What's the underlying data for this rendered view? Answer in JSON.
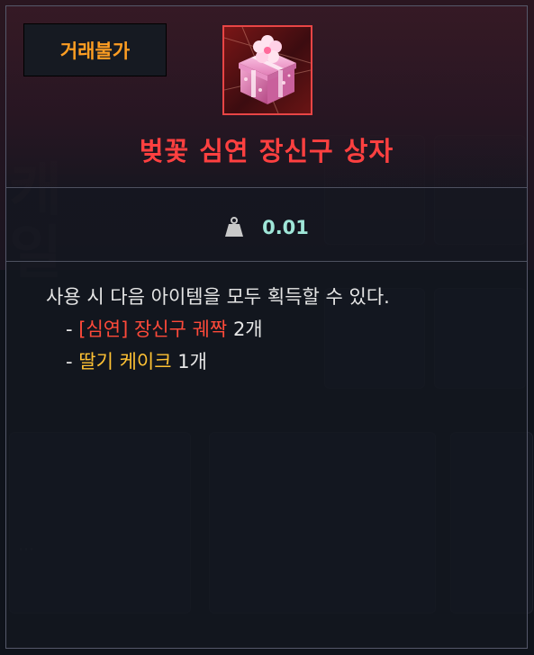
{
  "badge": {
    "label": "거래불가"
  },
  "item": {
    "name": "벚꽃 심연 장신구 상자",
    "weight": "0.01",
    "icon": "pink-gift-box-icon",
    "name_color": "#ff4040",
    "frame_color": "#e84545"
  },
  "weight_icon": "weight-icon",
  "description": {
    "intro": "사용 시 다음 아이템을 모두 획득할 수 있다.",
    "items": [
      {
        "bullet": "-",
        "name": "[심연] 장신구 궤짝",
        "name_color": "#ff4a3a",
        "qty": "2개"
      },
      {
        "bullet": "-",
        "name": "딸기 케이크",
        "name_color": "#ffc234",
        "qty": "1개"
      }
    ]
  },
  "colors": {
    "badge_text": "#ff9e22",
    "weight_value": "#9fe6d8"
  }
}
